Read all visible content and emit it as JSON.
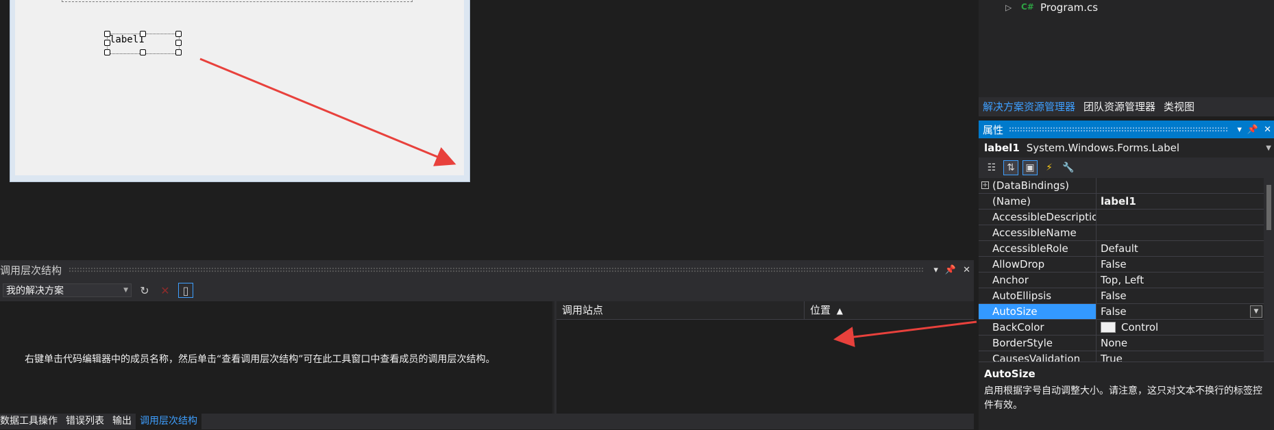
{
  "designer": {
    "label_control_text": "label1"
  },
  "solution_explorer": {
    "file_badge": "C#",
    "file_name": "Program.cs",
    "tabs": [
      "解决方案资源管理器",
      "团队资源管理器",
      "类视图"
    ]
  },
  "properties": {
    "title": "属性",
    "object_name": "label1",
    "object_type": "System.Windows.Forms.Label",
    "rows": [
      {
        "name": "(DataBindings)",
        "value": "",
        "expander": "+"
      },
      {
        "name": "(Name)",
        "value": "label1",
        "bold": true
      },
      {
        "name": "AccessibleDescription",
        "value": ""
      },
      {
        "name": "AccessibleName",
        "value": ""
      },
      {
        "name": "AccessibleRole",
        "value": "Default"
      },
      {
        "name": "AllowDrop",
        "value": "False"
      },
      {
        "name": "Anchor",
        "value": "Top, Left"
      },
      {
        "name": "AutoEllipsis",
        "value": "False"
      },
      {
        "name": "AutoSize",
        "value": "False",
        "selected": true
      },
      {
        "name": "BackColor",
        "value": "Control",
        "swatch": "#f0f0f0"
      },
      {
        "name": "BorderStyle",
        "value": "None"
      },
      {
        "name": "CausesValidation",
        "value": "True"
      },
      {
        "name": "",
        "value": ""
      }
    ],
    "description_title": "AutoSize",
    "description_text": "启用根据字号自动调整大小。请注意，这只对文本不换行的标签控件有效。"
  },
  "call_hierarchy": {
    "title": "调用层次结构",
    "scope": "我的解决方案",
    "empty_message": "右键单击代码编辑器中的成员名称，然后单击“查看调用层次结构”可在此工具窗口中查看成员的调用层次结构。",
    "col_call_site": "调用站点",
    "col_location": "位置",
    "sort_indicator": "▲"
  },
  "bottom_tabs": [
    "数据工具操作",
    "错误列表",
    "输出",
    "调用层次结构"
  ],
  "colors": {
    "accent": "#007acc",
    "selected_row": "#3399ff",
    "arrow": "#e8413c"
  }
}
